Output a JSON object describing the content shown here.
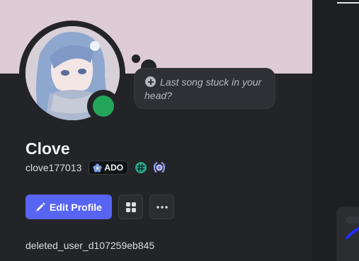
{
  "profile": {
    "display_name": "Clove",
    "username": "clove177013",
    "guild_tag": {
      "text": "ADO",
      "icon": "blue-flower-icon"
    },
    "status": "online",
    "status_color": "#23a55a",
    "banner_color": "#ddcbd6",
    "deleted_user": "deleted_user_d107259eb845"
  },
  "note": {
    "icon": "plus-circle-icon",
    "placeholder": "Last song stuck in your head?"
  },
  "badges": [
    {
      "name": "hypesquad-badge",
      "icon": "hash-badge-icon",
      "color": "#2aa58a"
    },
    {
      "name": "quest-badge",
      "icon": "laurel-badge-icon",
      "color": "#9aa2ff"
    }
  ],
  "actions": {
    "edit_profile_label": "Edit Profile",
    "edit_icon": "pencil-icon",
    "orbs_icon": "orbs-shop-icon",
    "more_icon": "ellipsis-icon",
    "accent_color": "#5865f2"
  }
}
